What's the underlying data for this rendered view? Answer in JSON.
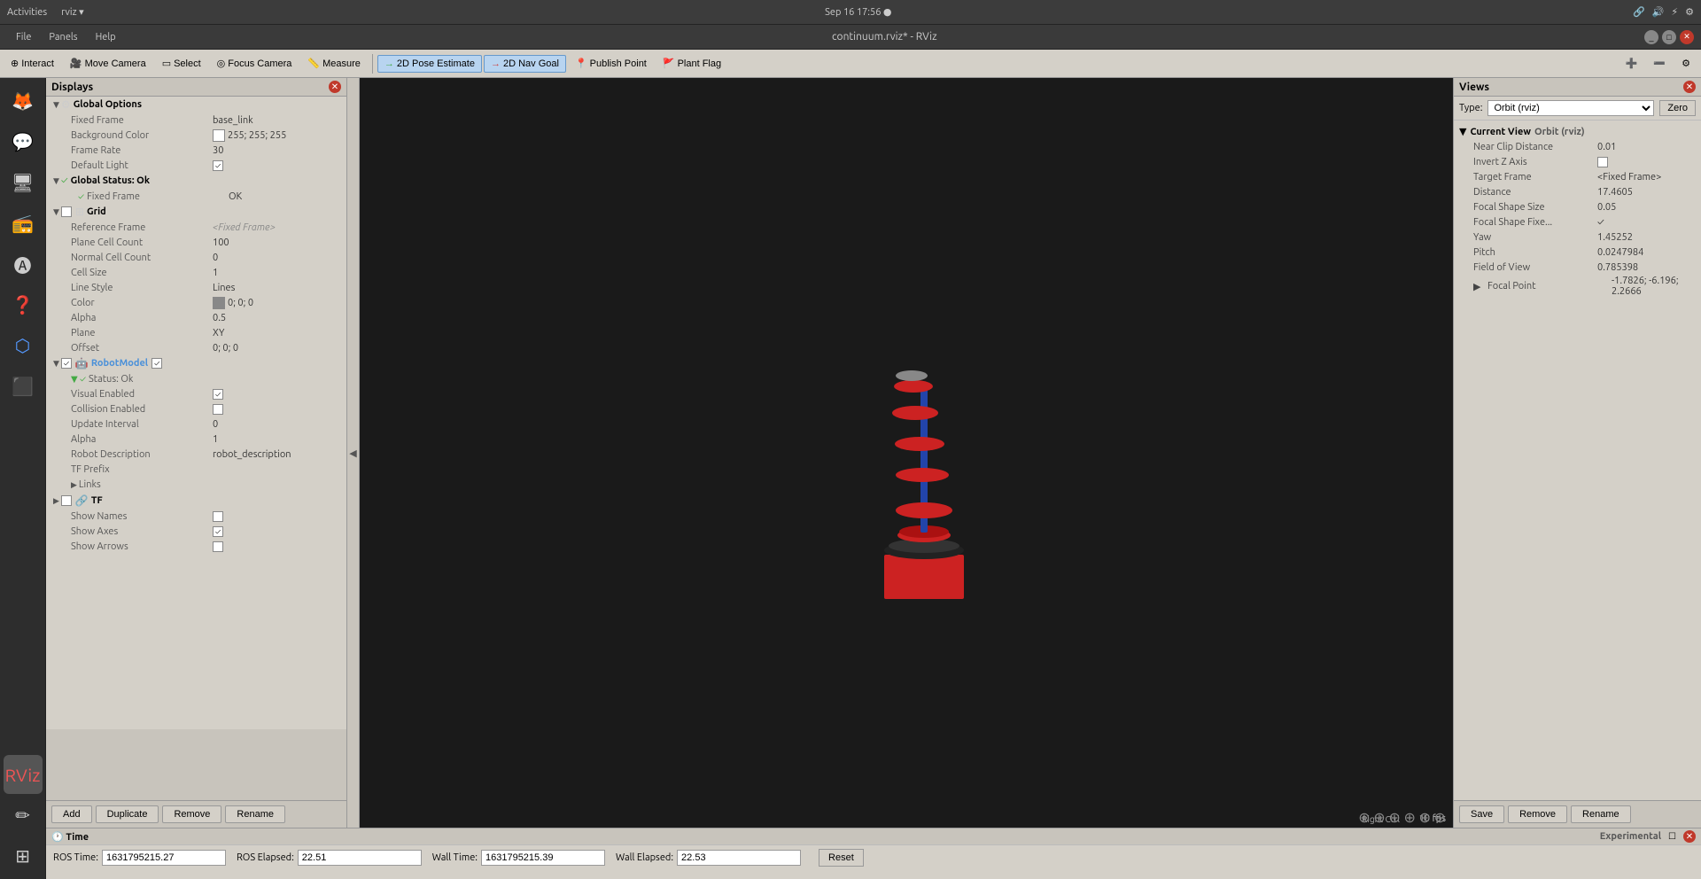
{
  "system_bar": {
    "left": [
      "Activities",
      "rviz ▾"
    ],
    "center": "Sep 16  17:56  ●",
    "right": [
      "🔇",
      "🔊",
      "⚡",
      "📶"
    ]
  },
  "app_titlebar": {
    "menu_items": [
      "File",
      "Panels",
      "Help"
    ],
    "title": "continuum.rviz* - RViz",
    "window_controls": [
      "_",
      "□",
      "✕"
    ]
  },
  "toolbar": {
    "buttons": [
      {
        "id": "interact",
        "label": "Interact",
        "icon": "⊕"
      },
      {
        "id": "move-camera",
        "label": "Move Camera",
        "icon": "🎥"
      },
      {
        "id": "select",
        "label": "Select",
        "icon": "▭"
      },
      {
        "id": "focus-camera",
        "label": "Focus Camera",
        "icon": "◎"
      },
      {
        "id": "measure",
        "label": "Measure",
        "icon": "📏"
      },
      {
        "id": "2d-pose",
        "label": "2D Pose Estimate",
        "icon": "→"
      },
      {
        "id": "2d-nav",
        "label": "2D Nav Goal",
        "icon": "→"
      },
      {
        "id": "publish-point",
        "label": "Publish Point",
        "icon": "📍"
      },
      {
        "id": "plant-flag",
        "label": "Plant Flag",
        "icon": "🚩"
      }
    ]
  },
  "displays": {
    "title": "Displays",
    "global_options": {
      "label": "Global Options",
      "fixed_frame_label": "Fixed Frame",
      "fixed_frame_value": "base_link",
      "background_color_label": "Background Color",
      "background_color_value": "255; 255; 255",
      "frame_rate_label": "Frame Rate",
      "frame_rate_value": "30",
      "default_light_label": "Default Light",
      "default_light_value": "✓"
    },
    "global_status": {
      "label": "Global Status: Ok",
      "fixed_frame_label": "Fixed Frame",
      "fixed_frame_value": "OK"
    },
    "grid": {
      "label": "Grid",
      "reference_frame_label": "Reference Frame",
      "reference_frame_value": "<Fixed Frame>",
      "plane_cell_count_label": "Plane Cell Count",
      "plane_cell_count_value": "100",
      "normal_cell_count_label": "Normal Cell Count",
      "normal_cell_count_value": "0",
      "cell_size_label": "Cell Size",
      "cell_size_value": "1",
      "line_style_label": "Line Style",
      "line_style_value": "Lines",
      "color_label": "Color",
      "color_value": "0; 0; 0",
      "alpha_label": "Alpha",
      "alpha_value": "0.5",
      "plane_label": "Plane",
      "plane_value": "XY",
      "offset_label": "Offset",
      "offset_value": "0; 0; 0"
    },
    "robot_model": {
      "label": "RobotModel",
      "status_label": "Status: Ok",
      "visual_enabled_label": "Visual Enabled",
      "collision_enabled_label": "Collision Enabled",
      "update_interval_label": "Update Interval",
      "update_interval_value": "0",
      "alpha_label": "Alpha",
      "alpha_value": "1",
      "robot_description_label": "Robot Description",
      "robot_description_value": "robot_description",
      "tf_prefix_label": "TF Prefix",
      "links_label": "Links"
    },
    "tf": {
      "label": "TF",
      "show_names_label": "Show Names",
      "show_axes_label": "Show Axes",
      "show_arrows_label": "Show Arrows"
    },
    "footer_buttons": [
      "Add",
      "Duplicate",
      "Remove",
      "Rename"
    ]
  },
  "views": {
    "title": "Views",
    "type_label": "Type:",
    "type_value": "Orbit (rviz)",
    "zero_button": "Zero",
    "current_view": {
      "label": "Current View",
      "type": "Orbit (rviz)",
      "near_clip_distance_label": "Near Clip Distance",
      "near_clip_distance_value": "0.01",
      "invert_z_label": "Invert Z Axis",
      "target_frame_label": "Target Frame",
      "target_frame_value": "<Fixed Frame>",
      "distance_label": "Distance",
      "distance_value": "17.4605",
      "focal_shape_size_label": "Focal Shape Size",
      "focal_shape_size_value": "0.05",
      "focal_shape_fixed_label": "Focal Shape Fixe...",
      "focal_shape_fixed_value": "✓",
      "yaw_label": "Yaw",
      "yaw_value": "1.45252",
      "pitch_label": "Pitch",
      "pitch_value": "0.0247984",
      "field_of_view_label": "Field of View",
      "field_of_view_value": "0.785398",
      "focal_point_label": "Focal Point",
      "focal_point_value": "-1.7826; -6.196; 2.2666"
    },
    "footer_buttons": [
      "Save",
      "Remove",
      "Rename"
    ]
  },
  "time": {
    "title": "Time",
    "ros_time_label": "ROS Time:",
    "ros_time_value": "1631795215.27",
    "ros_elapsed_label": "ROS Elapsed:",
    "ros_elapsed_value": "22.51",
    "wall_time_label": "Wall Time:",
    "wall_time_value": "1631795215.39",
    "wall_elapsed_label": "Wall Elapsed:",
    "wall_elapsed_value": "22.53",
    "reset_button": "Reset",
    "experimental_label": "Experimental"
  },
  "viewport": {
    "fps": "10 fps",
    "bottom_right": "Right Ctrl"
  }
}
